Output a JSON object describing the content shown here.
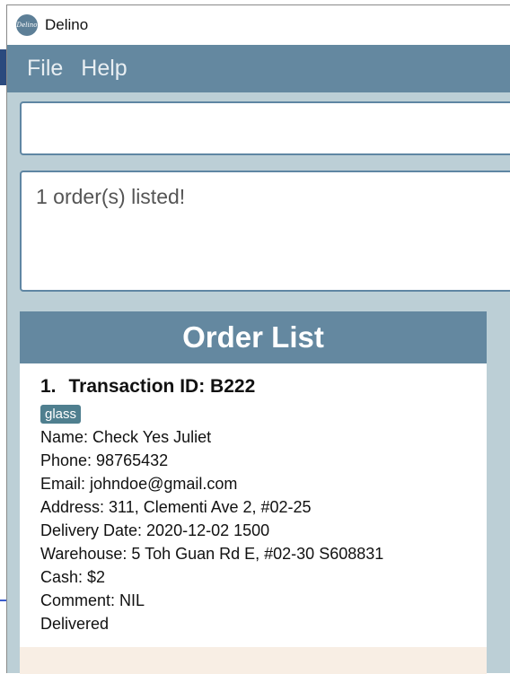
{
  "window": {
    "title": "Delino",
    "icon_text": "Delino"
  },
  "menu": {
    "items": [
      "File",
      "Help"
    ]
  },
  "command": {
    "value": ""
  },
  "result": {
    "text": "1 order(s) listed!"
  },
  "order_list": {
    "heading": "Order List",
    "orders": [
      {
        "index": "1.",
        "title": "Transaction ID: B222",
        "tag": "glass",
        "fields": [
          "Name: Check Yes Juliet",
          "Phone: 98765432",
          "Email: johndoe@gmail.com",
          "Address: 311, Clementi Ave 2, #02-25",
          "Delivery Date: 2020-12-02 1500",
          "Warehouse: 5 Toh Guan Rd E, #02-30 S608831",
          "Cash: $2",
          "Comment: NIL",
          "Delivered"
        ]
      }
    ]
  },
  "colors": {
    "menu_bar": "#6488a0",
    "window_bg": "#bccfd6",
    "tag_bg": "#4f7f8f",
    "next_card": "#f8eee4"
  }
}
